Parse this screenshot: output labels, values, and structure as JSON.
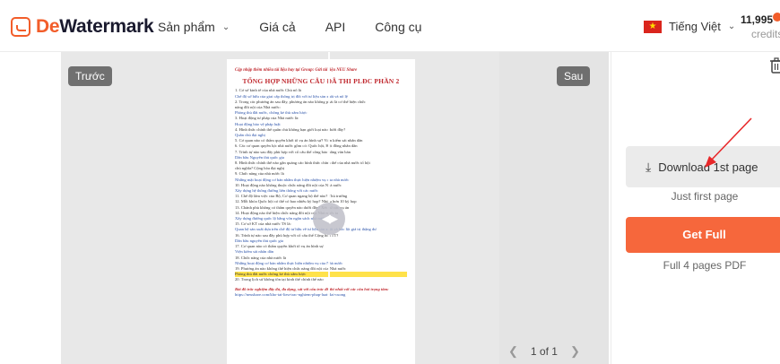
{
  "header": {
    "logo_text_accent": "De",
    "logo_text_rest": "Watermark",
    "nav": [
      {
        "label": "Sản phẩm",
        "has_dropdown": true
      },
      {
        "label": "Giá cả",
        "has_dropdown": false
      },
      {
        "label": "API",
        "has_dropdown": false
      },
      {
        "label": "Công cụ",
        "has_dropdown": false
      }
    ],
    "language": "Tiếng Việt",
    "credits_value": "11,995",
    "credits_label": "credits"
  },
  "viewer": {
    "before_label": "Trước",
    "after_label": "Sau",
    "page_indicator": "1 of 1",
    "document": {
      "header_line": "Cập nhập thêm nhiều tài liệu hay tại Group: Gửi tài liệu NEU Share",
      "title": "TỔNG HỢP NHỮNG CÂU ĐÃ THI PLĐC PHẦN 2",
      "lines": [
        {
          "text": "1.  Cơ sở kinh tế của nhà nước Chủ nô là",
          "style": "normal"
        },
        {
          "text": "Chế độ sở hữu của giai cấp thống trị đối với tư liệu sản xuất và nô lệ",
          "style": "blue"
        },
        {
          "text": "2.  Trong các phương án sau đây, phương án nào không phải là cơ thể hiện chức",
          "style": "normal"
        },
        {
          "text": "    năng đối nội của Nhà nước:",
          "style": "normal"
        },
        {
          "text": "Phòng thủ đất nước, chống kẻ thù xâm lược",
          "style": "blue"
        },
        {
          "text": "3.  Hoạt động tư pháp của Nhà nước là:",
          "style": "normal"
        },
        {
          "text": "Hoạt động bảo vệ pháp luật",
          "style": "blue"
        },
        {
          "text": "4.  Hình thức chính thể quân chủ không hạn giới loại nào dưới đây?",
          "style": "normal"
        },
        {
          "text": "Quân chủ đại nghị",
          "style": "blue"
        },
        {
          "text": "5.  Cơ quan nào có thẩm quyền khởi tố vụ án hình sự? Viện kiểm sát nhân dân",
          "style": "normal"
        },
        {
          "text": "6.  Các cơ quan quyền lực nhà nước gồm có: Quốc hội, Hội đồng nhân dân",
          "style": "normal"
        },
        {
          "text": "7.  Trình tự nào sau đây phù hợp với cổ cấu thể công bảo bằng văn bản",
          "style": "normal"
        },
        {
          "text": "Dân bầu Nguyên thủ quốc gia",
          "style": "blue"
        },
        {
          "text": "8.  Hình thức chính thể nào gắn quảng cáo hình thức chính thể của nhà nước tổ hội",
          "style": "normal"
        },
        {
          "text": "    chủ nghĩa? Cộng hòa đại nghị",
          "style": "normal"
        },
        {
          "text": "9.  Chức năng của nhà nước là",
          "style": "normal"
        },
        {
          "text": "Những mặt hoạt động cơ bản nhằm thực hiện nhiệm vụ của nhà nước",
          "style": "blue"
        },
        {
          "text": "10. Hoạt động nào không thuộc chức năng đối nội của Nhà nước",
          "style": "normal"
        },
        {
          "text": "Xây dựng hệ thống đường liên thông với các nước",
          "style": "blue"
        },
        {
          "text": "11. Chế độ lâm việc của Bộ, Cơ quan ngang bộ thế nào? Thủ trưởng",
          "style": "normal"
        },
        {
          "text": "12. Mỗi khóa Quốc hội có thể có bao nhiêu kỳ họp? Nhiều hơn 10 kỳ họp",
          "style": "normal"
        },
        {
          "text": "13. Chánh phủ không có thẩm quyền nào dưới đây? Xét xử các vụ án",
          "style": "normal"
        },
        {
          "text": "14. Hoạt động nào thể hiện chức năng đối nội của Nhà nước ta",
          "style": "normal"
        },
        {
          "text": "Xây dựng đường quốc lộ bằng vốn ngân sách nhà nước",
          "style": "blue"
        },
        {
          "text": "15. Cơ sở KT của nhà nước TS là:",
          "style": "normal"
        },
        {
          "text": "Quan hệ sản xuất dựa trên chế độ tư hữu về tư liệu sản xuất và bóc lột giá trị thặng dư",
          "style": "blue"
        },
        {
          "text": "16. Trình tự nào sau đây phù hợp với cổ cấu thể Cộng hòa TT?",
          "style": "normal"
        },
        {
          "text": "Dân bầu nguyên thủ quốc gia",
          "style": "blue"
        },
        {
          "text": "17. Cơ quan nào có thẩm quyền khởi tố vụ án hình sự",
          "style": "normal"
        },
        {
          "text": "Viện kiểm sát nhân dân",
          "style": "blue"
        },
        {
          "text": "18. Chức năng của nhà nước là",
          "style": "normal"
        },
        {
          "text": "Những hoạt động cơ bản nhằm thực hiện nhiệm vụ của Nhà nước",
          "style": "blue"
        },
        {
          "text": "19. Phương án nào không thể hiện chức năng đối nội của Nhà nước",
          "style": "normal"
        },
        {
          "text": "Phòng thủ đất nước chống kẻ thù xâm lược",
          "style": "yellow"
        },
        {
          "text": "20. Trong lịch sử không tồn tại kinh thể chính thể nào",
          "style": "normal"
        }
      ],
      "footer": "Bài đồ trắc nghiệm đầy đủ, đa dạng, sát với cấu trúc đề thi nhất với các câu hỏi trọng tâm:",
      "footer_link": "https://neushare.com/kho-tai-lieu-trac-nghiem-phap-luat-dai-cuong"
    }
  },
  "sidebar": {
    "download_label": "Download 1st page",
    "download_sub": "Just first page",
    "get_full_label": "Get Full",
    "get_full_sub": "Full 4 pages PDF"
  },
  "colors": {
    "brand": "#f25d2a",
    "get_full_bg": "#f6673c",
    "annotation_arrow": "#e8282a"
  }
}
